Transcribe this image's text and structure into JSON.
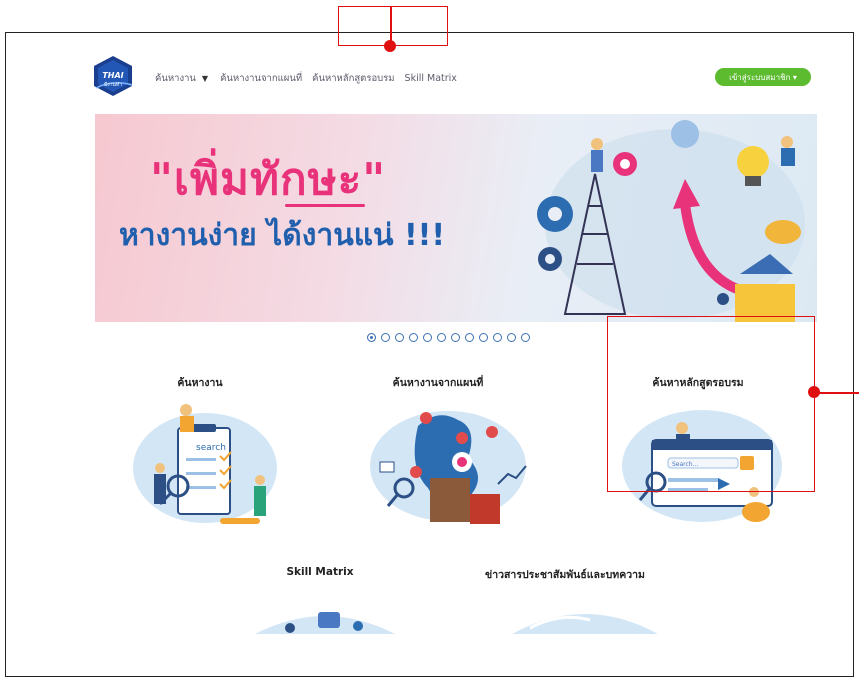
{
  "header": {
    "logo_text": "THAI",
    "logo_sub": "มีงานทำ",
    "nav": [
      {
        "label": "ค้นหางาน",
        "has_caret": true
      },
      {
        "label": "ค้นหางานจากแผนที่"
      },
      {
        "label": "ค้นหาหลักสูตรอบรม"
      },
      {
        "label": "Skill Matrix"
      }
    ],
    "caret": "▼",
    "login_label": "เข้าสู่ระบบสมาชิก ▾"
  },
  "banner": {
    "headline_1": "\"เพิ่มทักษะ\"",
    "headline_2": "หางานง่าย ได้งานแน่ !!!"
  },
  "carousel": {
    "count": 12,
    "active_index": 0
  },
  "cards": [
    {
      "title": "ค้นหางาน",
      "search_word": "search"
    },
    {
      "title": "ค้นหางานจากแผนที่"
    },
    {
      "title": "ค้นหาหลักสูตรอบรม",
      "search_word": "Search..."
    },
    {
      "title": "Skill Matrix"
    },
    {
      "title": "ข่าวสารประชาสัมพันธ์และบทความ"
    }
  ],
  "colors": {
    "brand_blue": "#1f5fad",
    "brand_pink": "#e8327a",
    "login_green": "#5dbb2f",
    "annotation_red": "#e01010"
  }
}
